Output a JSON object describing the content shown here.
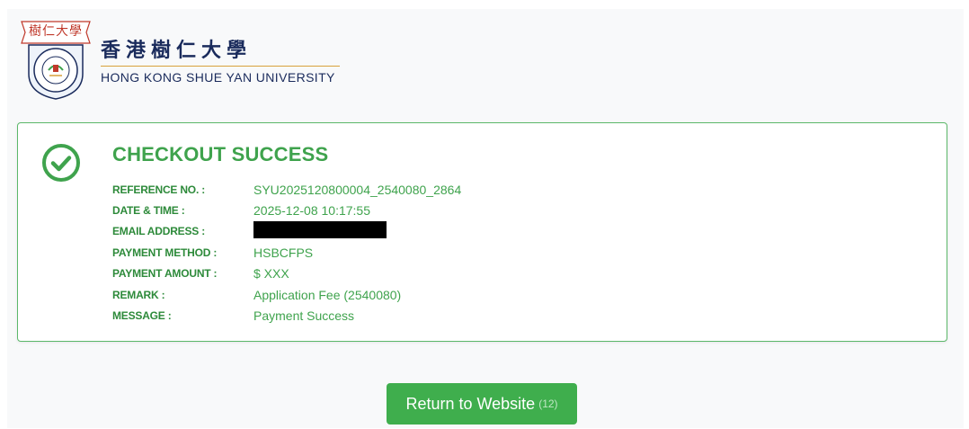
{
  "header": {
    "crest_banner": "樹仁大學",
    "crest_ring_text": "SHUE YAN UNIVERSITY",
    "university_cn": "香港樹仁大學",
    "university_en": "HONG KONG SHUE YAN UNIVERSITY"
  },
  "result": {
    "title": "CHECKOUT SUCCESS",
    "status_icon": "check-circle-icon",
    "accent_color": "#3fa34d",
    "rows": [
      {
        "label": "REFERENCE NO. :",
        "value": "SYU2025120800004_2540080_2864"
      },
      {
        "label": "DATE & TIME :",
        "value": "2025-12-08 10:17:55"
      },
      {
        "label": "EMAIL ADDRESS :",
        "value": ""
      },
      {
        "label": "PAYMENT METHOD :",
        "value": "HSBCFPS"
      },
      {
        "label": "PAYMENT AMOUNT :",
        "value": "$ XXX"
      },
      {
        "label": "REMARK :",
        "value": "Application Fee (2540080)"
      },
      {
        "label": "MESSAGE :",
        "value": "Payment Success"
      }
    ]
  },
  "footer": {
    "return_label": "Return to Website",
    "countdown": "(12)",
    "button_color": "#3fae4d"
  }
}
